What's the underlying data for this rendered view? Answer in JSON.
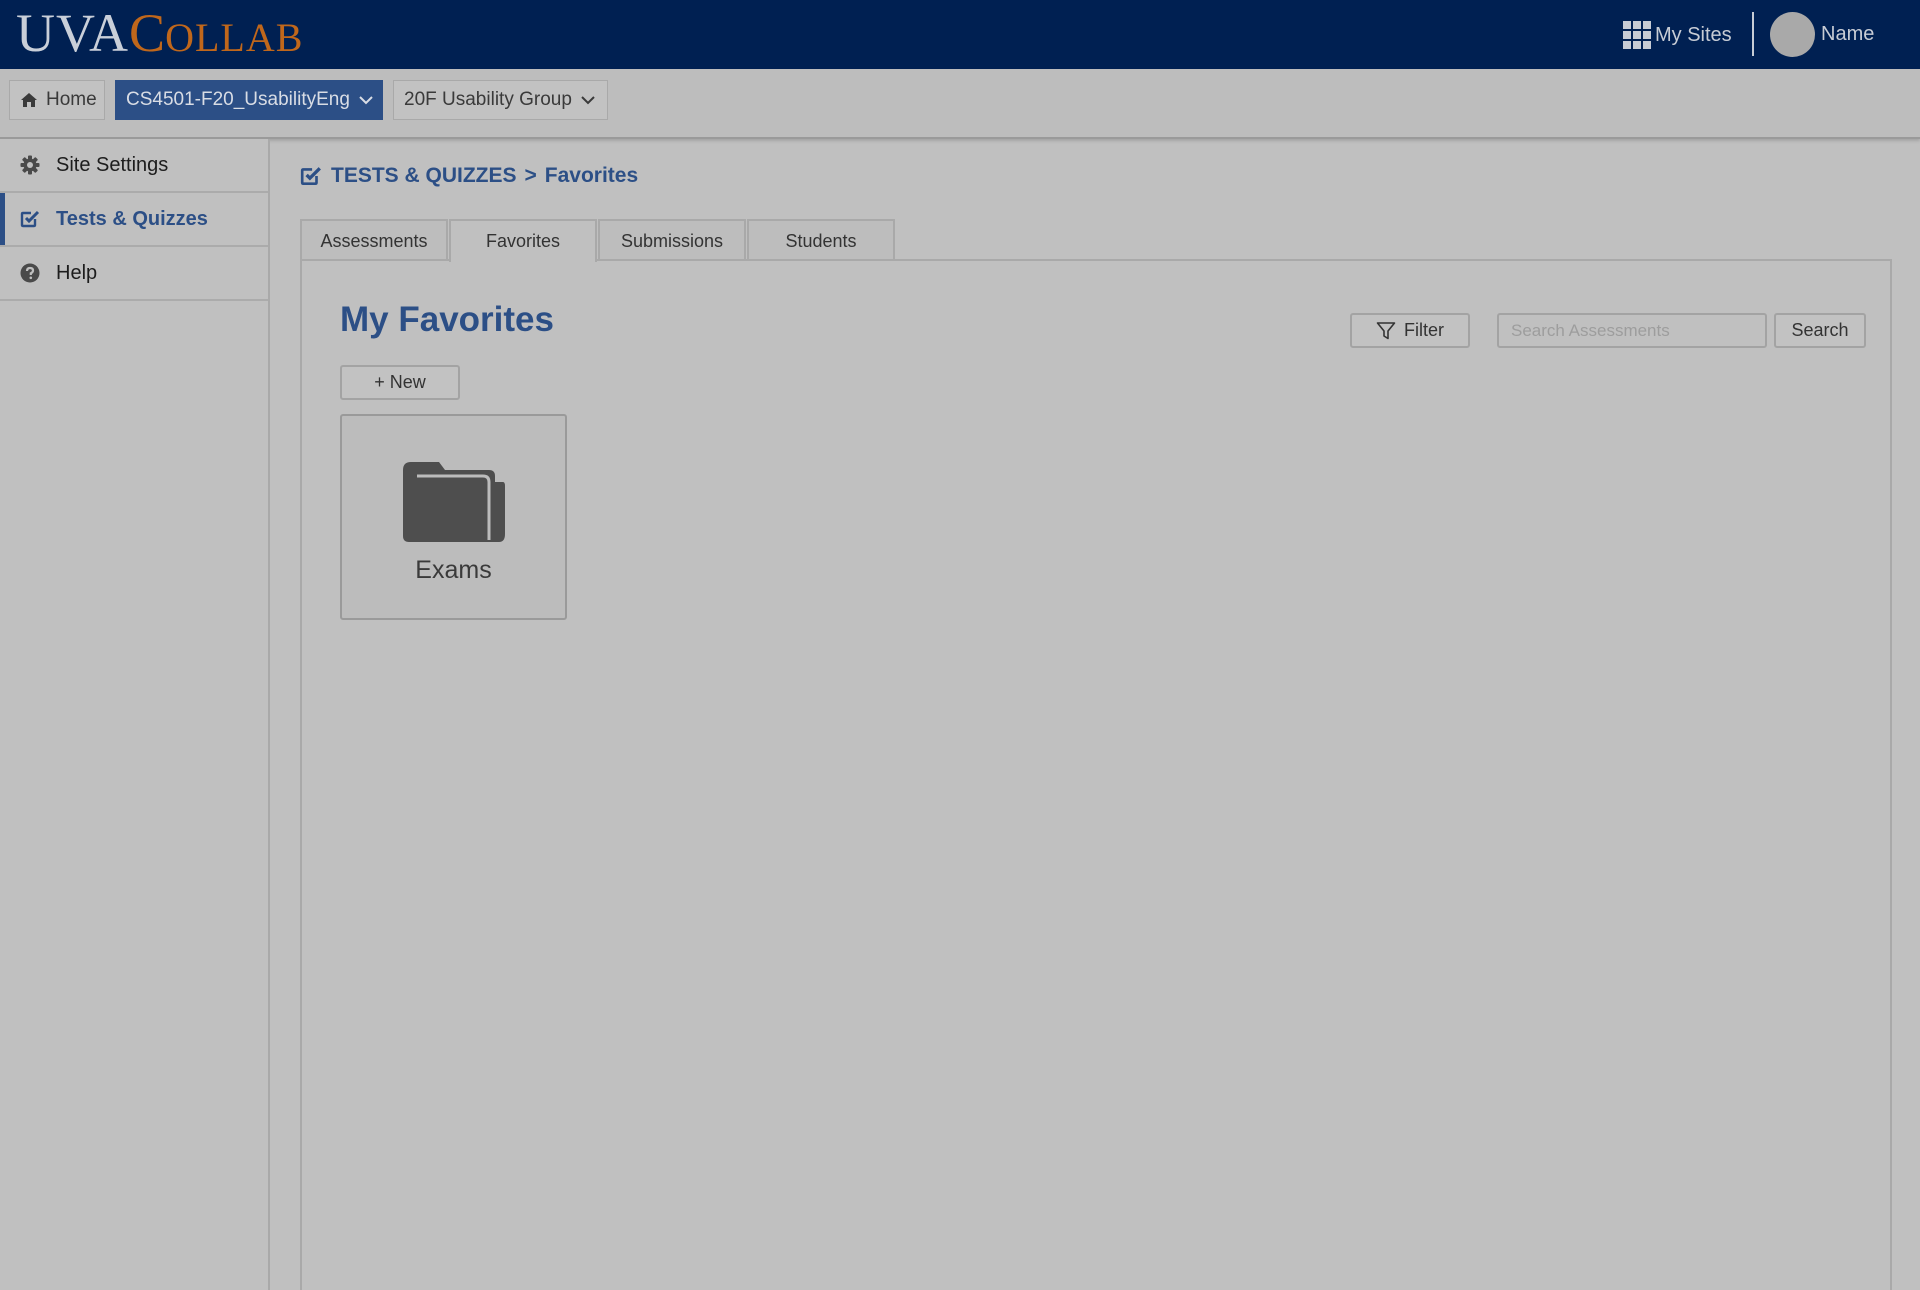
{
  "header": {
    "logo": {
      "part1": "UVA",
      "part2_big": "C",
      "part2_small": "OLLAB"
    },
    "my_sites_label": "My Sites",
    "user_name": "Name"
  },
  "sitenav": {
    "home_label": "Home",
    "current_site": "CS4501-F20_UsabilityEng",
    "group": "20F Usability Group"
  },
  "toolmenu": {
    "items": [
      {
        "label": "Site Settings",
        "icon": "gear-icon"
      },
      {
        "label": "Tests & Quizzes",
        "icon": "checkbox-icon",
        "active": true
      },
      {
        "label": "Help",
        "icon": "question-circle-icon"
      }
    ]
  },
  "breadcrumb": {
    "section": "TESTS & QUIZZES",
    "separator": ">",
    "page": "Favorites"
  },
  "tabs": [
    {
      "label": "Assessments"
    },
    {
      "label": "Favorites",
      "active": true
    },
    {
      "label": "Submissions"
    },
    {
      "label": "Students"
    }
  ],
  "main": {
    "title": "My Favorites",
    "new_button": "+ New",
    "filter_button": "Filter",
    "search_placeholder": "Search Assessments",
    "search_value": "",
    "search_button": "Search",
    "folders": [
      {
        "name": "Exams",
        "icon": "folder-icon"
      }
    ]
  },
  "colors": {
    "header_bg": "#002052",
    "brand_blue": "#2c4f86",
    "brand_orange": "#c0671b",
    "page_bg": "#c0c0c0"
  }
}
